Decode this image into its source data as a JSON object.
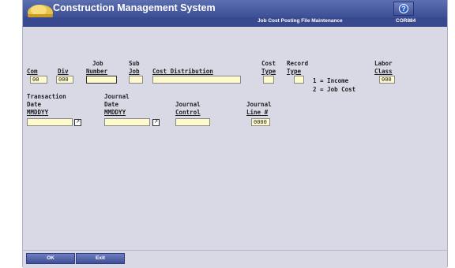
{
  "app": {
    "title": "Construction Management System",
    "help_label": "?",
    "screen_title": "Job Cost Posting File Maintenance",
    "screen_code": "COR884"
  },
  "labels": {
    "com": "Com",
    "div": "Div",
    "job_top": "Job",
    "job_bottom": "Number",
    "sub_top": "Sub",
    "sub_bottom": "Job",
    "cost_distribution": "Cost Distribution",
    "cost_type_top": "Cost",
    "cost_type_bottom": "Type",
    "record_type_top": "Record",
    "record_type_bottom": "Type",
    "income_option": "1 = Income",
    "jobcost_option": "2 = Job Cost",
    "labor_class_top": "Labor",
    "labor_class_bottom": "Class",
    "transaction_date_1": "Transaction",
    "transaction_date_2": "Date",
    "transaction_date_3": "MMDDYY",
    "journal_date_1": "Journal",
    "journal_date_2": "Date",
    "journal_date_3": "MMDDYY",
    "journal_control_1": "Journal",
    "journal_control_2": "Control",
    "journal_line_1": "Journal",
    "journal_line_2": "Line #"
  },
  "fields": {
    "com": "00",
    "div": "000",
    "job_number": "",
    "sub_job": "",
    "cost_distribution": "",
    "cost_type": "",
    "record_type": "",
    "labor_class": "000",
    "transaction_date": "",
    "journal_date": "",
    "journal_control": "",
    "journal_line": "0000"
  },
  "calendar_icon_glyph": "↗",
  "footer": {
    "ok_label": "OK",
    "exit_label": "Exit"
  },
  "colors": {
    "titlebar": "#4a5ca3",
    "subbar": "#39498f",
    "field_bg": "#fffacc",
    "panel_bg": "#d9d9e6"
  }
}
